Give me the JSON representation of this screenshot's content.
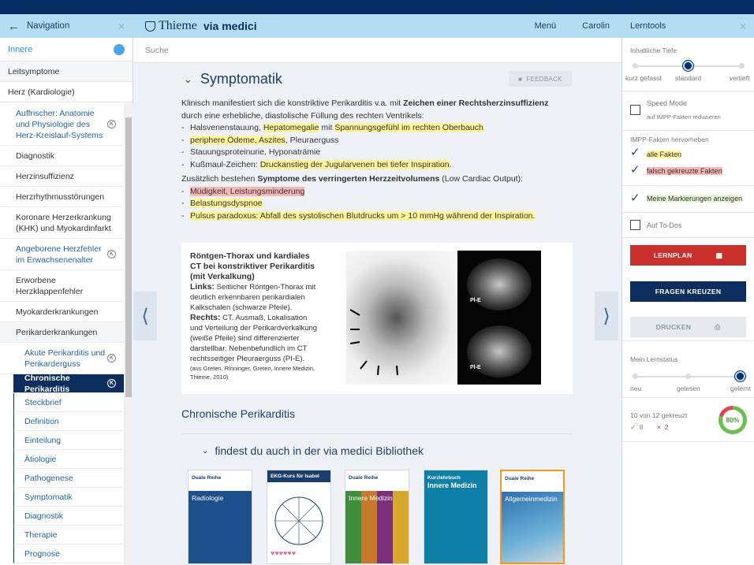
{
  "nav": {
    "title": "Navigation",
    "subject": "Innere",
    "level0": [
      "Leitsymptome",
      "Herz (Kardiologie)"
    ],
    "items": [
      {
        "label": "Auffrischer: Anatomie und Physiologie des Herz-Kreislauf-Systems",
        "type": "link",
        "badge": "K"
      },
      {
        "label": "Diagnostik",
        "type": "plain"
      },
      {
        "label": "Herzinsuffizienz",
        "type": "plain"
      },
      {
        "label": "Herzrhythmusstörungen",
        "type": "plain"
      },
      {
        "label": "Koronare Herzerkrankung (KHK) und Myokardinfarkt",
        "type": "plain"
      },
      {
        "label": "Angeborene Herzfehler im Erwachsenenalter",
        "type": "link",
        "badge": "K"
      },
      {
        "label": "Erworbene Herzklappenfehler",
        "type": "plain"
      },
      {
        "label": "Myokarderkrankungen",
        "type": "plain"
      },
      {
        "label": "Perikarderkrankungen",
        "type": "plain"
      }
    ],
    "sub_item": {
      "label": "Akute Perikarditis und Perikarderguss",
      "badge": "K"
    },
    "active_item": {
      "label": "Chronische Perikarditis",
      "badge": "K"
    },
    "leaves": [
      "Steckbrief",
      "Definition",
      "Einteilung",
      "Ätiologie",
      "Pathogenese",
      "Symptomatik",
      "Diagnostik",
      "Therapie",
      "Prognose"
    ]
  },
  "header": {
    "brand": "Thieme",
    "product": "via medici",
    "menu": "Menü",
    "user": "Carolin",
    "search_placeholder": "Suche"
  },
  "main": {
    "section_title": "Symptomatik",
    "feedback": "FEEDBACK",
    "intro_a": "Klinisch manifestiert sich die konstriktive Perikarditis v.a. mit ",
    "intro_bold": "Zeichen einer Rechtsherzinsuffizienz",
    "intro_b": " durch eine erhebliche, diastolische Füllung des rechten Ventrikels:",
    "list1": {
      "l1a": "Halsvenenstauung, ",
      "l1b": "Hepatomegalie",
      "l1c": " mit ",
      "l1d": "Spannungsgefühl im rechten Oberbauch",
      "l2a": "periphere Ödeme, ",
      "l2b": "Aszites",
      "l2c": ", Pleuraerguss",
      "l3": "Stauungsproteinurie, Hyponaträmie",
      "l4a": "Kußmaul-Zeichen: ",
      "l4b": "Druckanstieg der Jugularvenen bei tiefer Inspiration",
      "l4c": "."
    },
    "intro2_a": "Zusätzlich bestehen ",
    "intro2_bold": "Symptome des verringerten Herzzeitvolumens",
    "intro2_b": " (Low Cardiac Output):",
    "list2": {
      "m1": "Müdigkeit, Leistungsminderung",
      "m2": "Belastungsdyspnoe",
      "m3": "Pulsus paradoxus: Abfall des systolischen Blutdrucks um > 10 mmHg während der Inspiration."
    },
    "figure": {
      "title": "Röntgen-Thorax und kardiales CT bei konstriktiver Perikarditis (mit Verkalkung)",
      "links_label": "Links:",
      "links_text": " Seitlicher Röntgen-Thorax mit deutlich erkennbaren perikardialen Kalkschalen (schwarze Pfeile).",
      "rechts_label": "Rechts:",
      "rechts_text": " CT. Ausmaß, Lokalisation und Verteilung der Perikardverkalkung (weiße Pfeile) sind differenzierter darstellbar. Nebenbefundlich im CT rechtsseitiger Pleuraerguss (PI-E).",
      "source": "(aus Greten, Rinninger, Greten, Innere Medizin, Thieme, 2010)",
      "ct_label": "Pl-E"
    },
    "heading2": "Chronische Perikarditis",
    "library_title": "findest du auch in der via medici Bibliothek",
    "books": [
      {
        "series": "Duale Reihe",
        "name": "Radiologie",
        "color": "#1d4f8c"
      },
      {
        "series": "EKG-Kurs für Isabel",
        "name": "",
        "color": "#ffffff"
      },
      {
        "series": "Duale Reihe",
        "name": "Innere Medizin",
        "color": "#3f8f3a"
      },
      {
        "series": "Kurzlehrbuch",
        "name": "Innere Medizin",
        "color": "#0e7fa6"
      },
      {
        "series": "Duale Reihe",
        "name": "Allgemeinmedizin",
        "color": "#2f6fb0"
      }
    ]
  },
  "tools": {
    "title": "Lerntools",
    "depth_label": "Inhaltliche Tiefe",
    "depth_options": [
      "kurz gefasst",
      "standard",
      "vertieft"
    ],
    "depth_selected": 1,
    "speed_mode": "Speed Mode",
    "speed_mode_sub": "auf IMPP-Fakten reduzieren",
    "impp_label": "IMPP-Fakten hervorheben",
    "all_facts": "alle Fakten",
    "wrong_facts": "falsch gekreuzte Fakten",
    "show_marks": "Meine Markierungen anzeigen",
    "todo": "Auf To-Dos",
    "lernplan": "LERNPLAN",
    "fragen": "FRAGEN KREUZEN",
    "drucken": "DRUCKEN",
    "status_label": "Mein Lernstatus",
    "status_options": [
      "neu",
      "gelesen",
      "gelernt"
    ],
    "status_selected": 2,
    "progress_text": "10 von 12 gekreuzt",
    "correct": "8",
    "wrong": "2",
    "percent_label": "80%",
    "percent_value": 0.8,
    "colors": {
      "accent_dark": "#0c2e5e",
      "lernplan_red": "#c9302c",
      "header_blue": "#b3ddf2",
      "highlight_yellow": "#fff59a",
      "highlight_red": "#f7b7b4"
    }
  }
}
